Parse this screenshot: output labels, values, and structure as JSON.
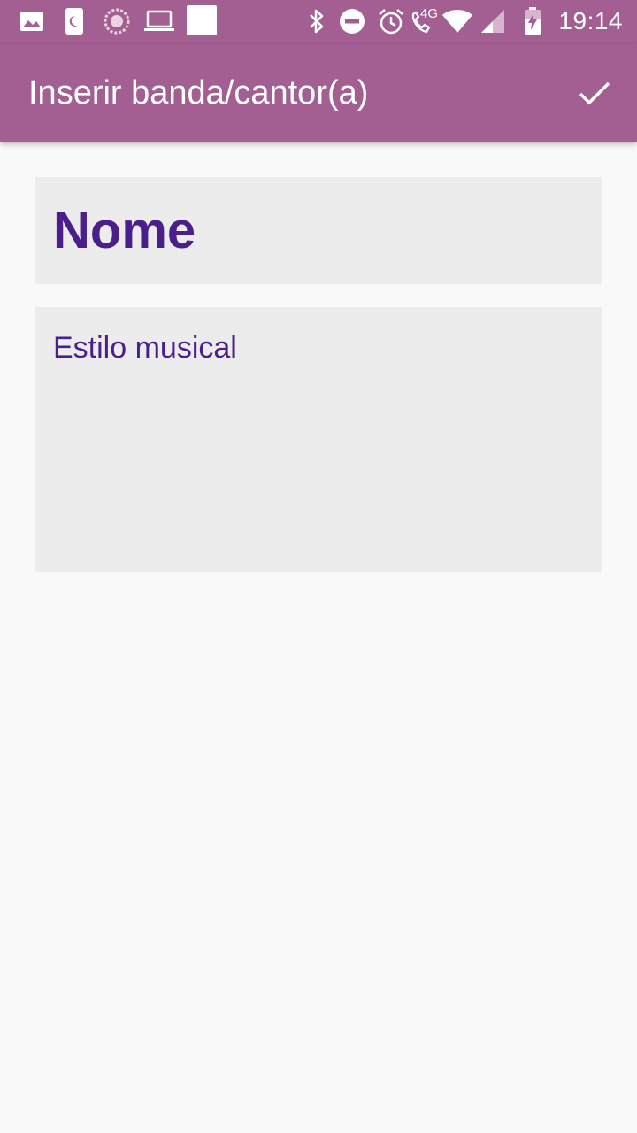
{
  "status_bar": {
    "time": "19:14",
    "network_label": "4G",
    "icons_left": [
      "gallery-icon",
      "phone-dnd-icon",
      "sync-circle-icon",
      "laptop-icon",
      "blank-square-icon"
    ],
    "icons_right": [
      "bluetooth-icon",
      "do-not-disturb-icon",
      "alarm-icon",
      "wifi-calling-4g-icon",
      "wifi-icon",
      "signal-icon",
      "battery-charging-icon"
    ]
  },
  "app_bar": {
    "title": "Inserir banda/cantor(a)",
    "confirm_icon": "check-icon"
  },
  "form": {
    "name_placeholder": "Nome",
    "style_placeholder": "Estilo musical"
  },
  "colors": {
    "primary": "#a35f91",
    "text_accent": "#4a1f8c",
    "field_background": "#ececec",
    "page_background": "#f9f9f9"
  }
}
